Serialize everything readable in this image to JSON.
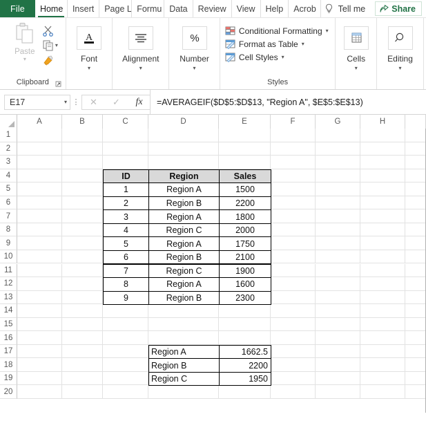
{
  "ribbon": {
    "file_tab": "File",
    "tabs": [
      {
        "label": "Home",
        "active": true
      },
      {
        "label": "Insert",
        "active": false
      },
      {
        "label": "Page L",
        "active": false
      },
      {
        "label": "Formu",
        "active": false
      },
      {
        "label": "Data",
        "active": false
      },
      {
        "label": "Review",
        "active": false
      },
      {
        "label": "View",
        "active": false
      },
      {
        "label": "Help",
        "active": false
      },
      {
        "label": "Acrob",
        "active": false
      }
    ],
    "tell_me": "Tell me",
    "share": "Share",
    "groups": {
      "clipboard": {
        "label": "Clipboard",
        "paste": "Paste",
        "cut_name": "cut",
        "copy_name": "copy",
        "format_painter_name": "format-painter"
      },
      "font": {
        "label": "Font"
      },
      "alignment": {
        "label": "Alignment"
      },
      "number": {
        "label": "Number"
      },
      "styles": {
        "label": "Styles",
        "items": [
          {
            "label": "Conditional Formatting",
            "caret": "∨"
          },
          {
            "label": "Format as Table",
            "caret": "∨"
          },
          {
            "label": "Cell Styles",
            "caret": "∨"
          }
        ]
      },
      "cells": {
        "label": "Cells"
      },
      "editing": {
        "label": "Editing"
      }
    }
  },
  "formula_bar": {
    "name_box": "E17",
    "cancel_icon": "✕",
    "enter_icon": "✓",
    "function_icon": "fx",
    "formula": "=AVERAGEIF($D$5:$D$13, \"Region A\", $E$5:$E$13)"
  },
  "sheet": {
    "columns": [
      "A",
      "B",
      "C",
      "D",
      "E",
      "F",
      "G",
      "H"
    ],
    "rows": [
      1,
      2,
      3,
      4,
      5,
      6,
      7,
      8,
      9,
      10,
      11,
      12,
      13,
      14,
      15,
      16,
      17,
      18,
      19,
      20
    ],
    "table": {
      "headers": [
        "ID",
        "Region",
        "Sales"
      ],
      "rows": [
        {
          "id": "1",
          "region": "Region A",
          "sales": "1500"
        },
        {
          "id": "2",
          "region": "Region B",
          "sales": "2200"
        },
        {
          "id": "3",
          "region": "Region A",
          "sales": "1800"
        },
        {
          "id": "4",
          "region": "Region C",
          "sales": "2000"
        },
        {
          "id": "5",
          "region": "Region A",
          "sales": "1750"
        },
        {
          "id": "6",
          "region": "Region B",
          "sales": "2100"
        },
        {
          "id": "7",
          "region": "Region C",
          "sales": "1900"
        },
        {
          "id": "8",
          "region": "Region A",
          "sales": "1600"
        },
        {
          "id": "9",
          "region": "Region B",
          "sales": "2300"
        }
      ]
    },
    "results": [
      {
        "label": "Region A",
        "value": "1662.5"
      },
      {
        "label": "Region B",
        "value": "2200"
      },
      {
        "label": "Region C",
        "value": "1950"
      }
    ]
  },
  "colors": {
    "excel_green": "#217346",
    "header_fill": "#d9d9d9",
    "gridline": "#e2e2e2"
  }
}
